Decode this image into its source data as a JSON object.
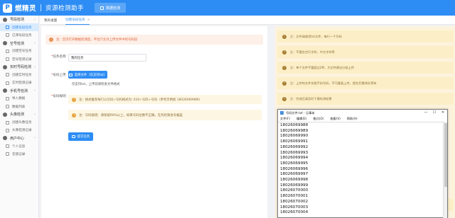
{
  "header": {
    "logo_mark": "P",
    "app_name": "燃精灵",
    "app_subtitle": "资源检测助手",
    "top_tab": "数据检测"
  },
  "sidebar": {
    "items": [
      {
        "type": "group",
        "label": "号段检测"
      },
      {
        "type": "sub",
        "label": "创建号段任务",
        "active": true
      },
      {
        "type": "sub",
        "label": "已添号段任务"
      },
      {
        "type": "group",
        "label": "空号检测"
      },
      {
        "type": "sub",
        "label": "创建空号任务"
      },
      {
        "type": "sub",
        "label": "空号检测记录"
      },
      {
        "type": "group",
        "label": "实时号码检测"
      },
      {
        "type": "sub",
        "label": "创建实时任务"
      },
      {
        "type": "sub",
        "label": "实时检测记录"
      },
      {
        "type": "group",
        "label": "手机号检测"
      },
      {
        "type": "sub",
        "label": "导入数据"
      },
      {
        "type": "sub",
        "label": "数据列表"
      },
      {
        "type": "group",
        "label": "头像检测"
      },
      {
        "type": "sub",
        "label": "创建头像任务"
      },
      {
        "type": "sub",
        "label": "头像检测记录"
      },
      {
        "type": "group",
        "label": "用户中心"
      },
      {
        "type": "sub",
        "label": "个人信息"
      },
      {
        "type": "sub",
        "label": "充值记录"
      }
    ]
  },
  "tabs": [
    {
      "label": "我的桌面"
    },
    {
      "label": "创建号段任务",
      "active": true,
      "close": "×"
    }
  ],
  "form": {
    "notice": "注：首次打开数据检测后，平台只允许上传文件中的号码段",
    "task_name_label": "任务名称",
    "task_name_value": "我的任务",
    "upload_label": "号码上传",
    "upload_button": "选择文件（仅支持txt）",
    "file_hint": "仅支持txt，上传前请检查文件格式",
    "rule_label": "号码规则",
    "rule_note_1": "注：格式推荐每行以号码+号码格式为: 010+号码+号码（参考示例如 18026069989）",
    "rule_note_2": "注：号码规则：请保留90%以上，如果号码位数不正确，任务结果会有偏差",
    "submit_button": "提交任务"
  },
  "tips": [
    "注：文件请使用txt文件，每行一个号码",
    "注：不要含空行字符，中文字符等",
    "注：单个文件不要超过2M，大文件建议分批上传",
    "注：上传的文件仅限手机号码，不可重复上传，提交后需排队等待",
    "注：完成后请及时下载检测结果",
    "注：如遇问题，请联系在线客服获取帮助"
  ],
  "notepad": {
    "title": "号码文件.txt - 记事本",
    "window_controls": [
      "—",
      "☐",
      "✕"
    ],
    "menu": [
      "文件(F)",
      "编辑(E)",
      "格式(O)",
      "查看(V)",
      "帮助(H)"
    ],
    "lines": [
      "18026069988",
      "18026069989",
      "18026069990",
      "18026069991",
      "18026069992",
      "18026069993",
      "18026069994",
      "18026069995",
      "18026069996",
      "18026069997",
      "18026069998",
      "18026069999",
      "18026070000",
      "18026070001",
      "18026070002",
      "18026070003",
      "18026070004"
    ]
  }
}
